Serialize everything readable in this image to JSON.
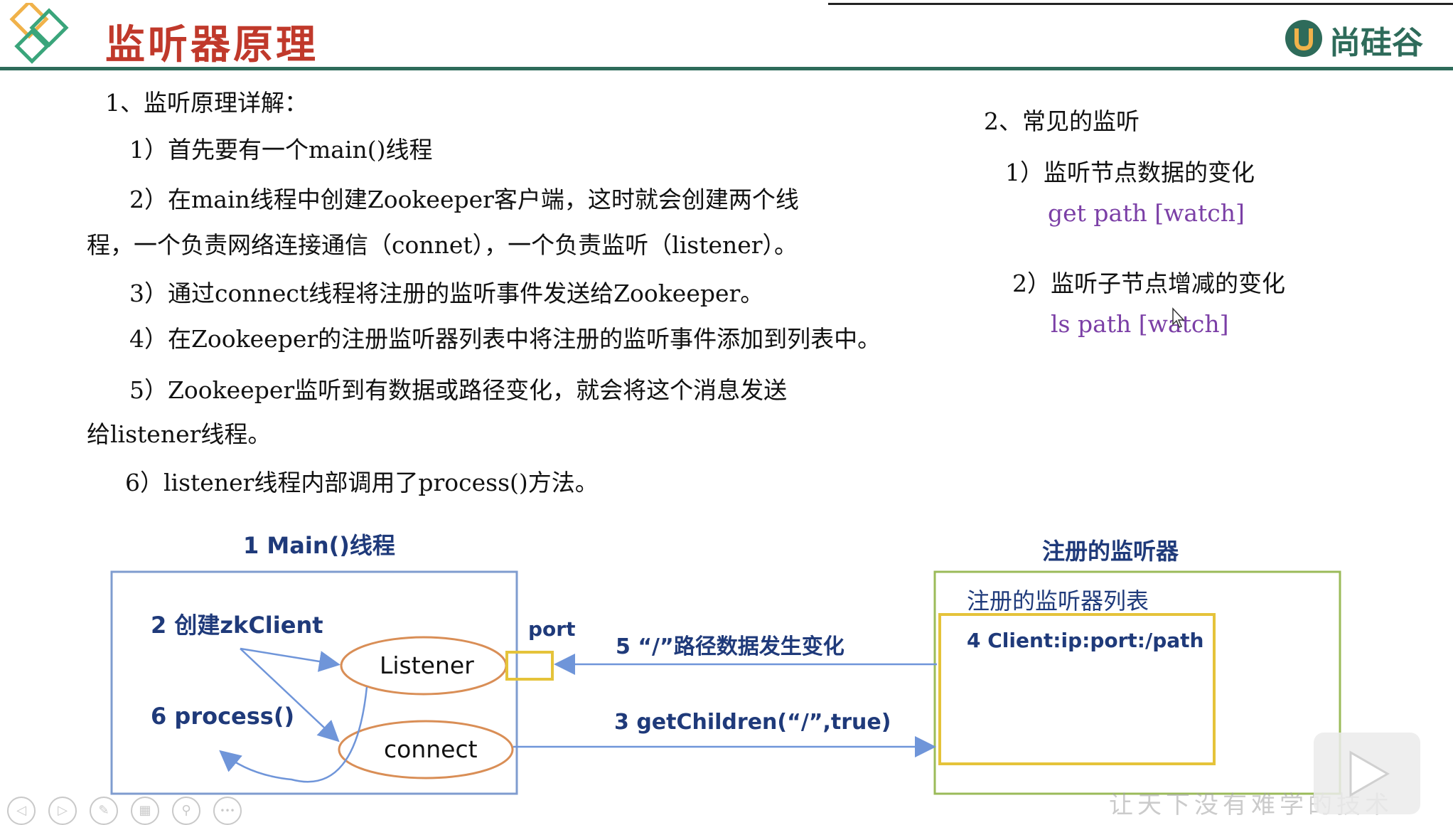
{
  "header": {
    "title": "监听器原理",
    "logo_text": "尚硅谷",
    "logo_mark": "U"
  },
  "left_section": {
    "heading": "1、监听原理详解：",
    "step1": "1）首先要有一个main()线程",
    "step2_line1": "2）在main线程中创建Zookeeper客户端，这时就会创建两个线",
    "step2_line2": "程，一个负责网络连接通信（connet），一个负责监听（listener）。",
    "step3": "3）通过connect线程将注册的监听事件发送给Zookeeper。",
    "step4": "4）在Zookeeper的注册监听器列表中将注册的监听事件添加到列表中。",
    "step5_line1": "5）Zookeeper监听到有数据或路径变化，就会将这个消息发送",
    "step5_line2": "给listener线程。",
    "step6": "6）listener线程内部调用了process()方法。"
  },
  "right_section": {
    "heading": "2、常见的监听",
    "item1": "1）监听节点数据的变化",
    "item1_cmd": "get path [watch]",
    "item2": "2）监听子节点增减的变化",
    "item2_cmd": "ls path [watch]"
  },
  "diagram": {
    "main_thread_title": "1 Main()线程",
    "registered_listener_title": "注册的监听器",
    "create_client": "2 创建zkClient",
    "process": "6 process()",
    "listener_node": "Listener",
    "connect_node": "connect",
    "port_label": "port",
    "arrow5_label": "5 “/”路径数据发生变化",
    "arrow3_label": "3 getChildren(“/”,true)",
    "list_title": "注册的监听器列表",
    "list_entry": "4 Client:ip:port:/path"
  },
  "watermark_text": "让天下没有难学的技术",
  "toolbar": {
    "buttons": [
      "back-icon",
      "forward-icon",
      "pen-icon",
      "grid-icon",
      "zoom-icon",
      "more-icon"
    ],
    "glyphs": [
      "◁",
      "▷",
      "✎",
      "▦",
      "⚲",
      "•••"
    ]
  },
  "colors": {
    "title_red": "#c0392b",
    "header_green": "#2e6b5a",
    "command_purple": "#7b3fa6",
    "diagram_blue": "#1f3a7a",
    "main_box_border": "#7f9ccf",
    "register_box_border": "#9bbb59",
    "list_box_border": "#e5c33a",
    "ellipse_border": "#d98e56",
    "arrow_blue": "#6f95d9"
  }
}
